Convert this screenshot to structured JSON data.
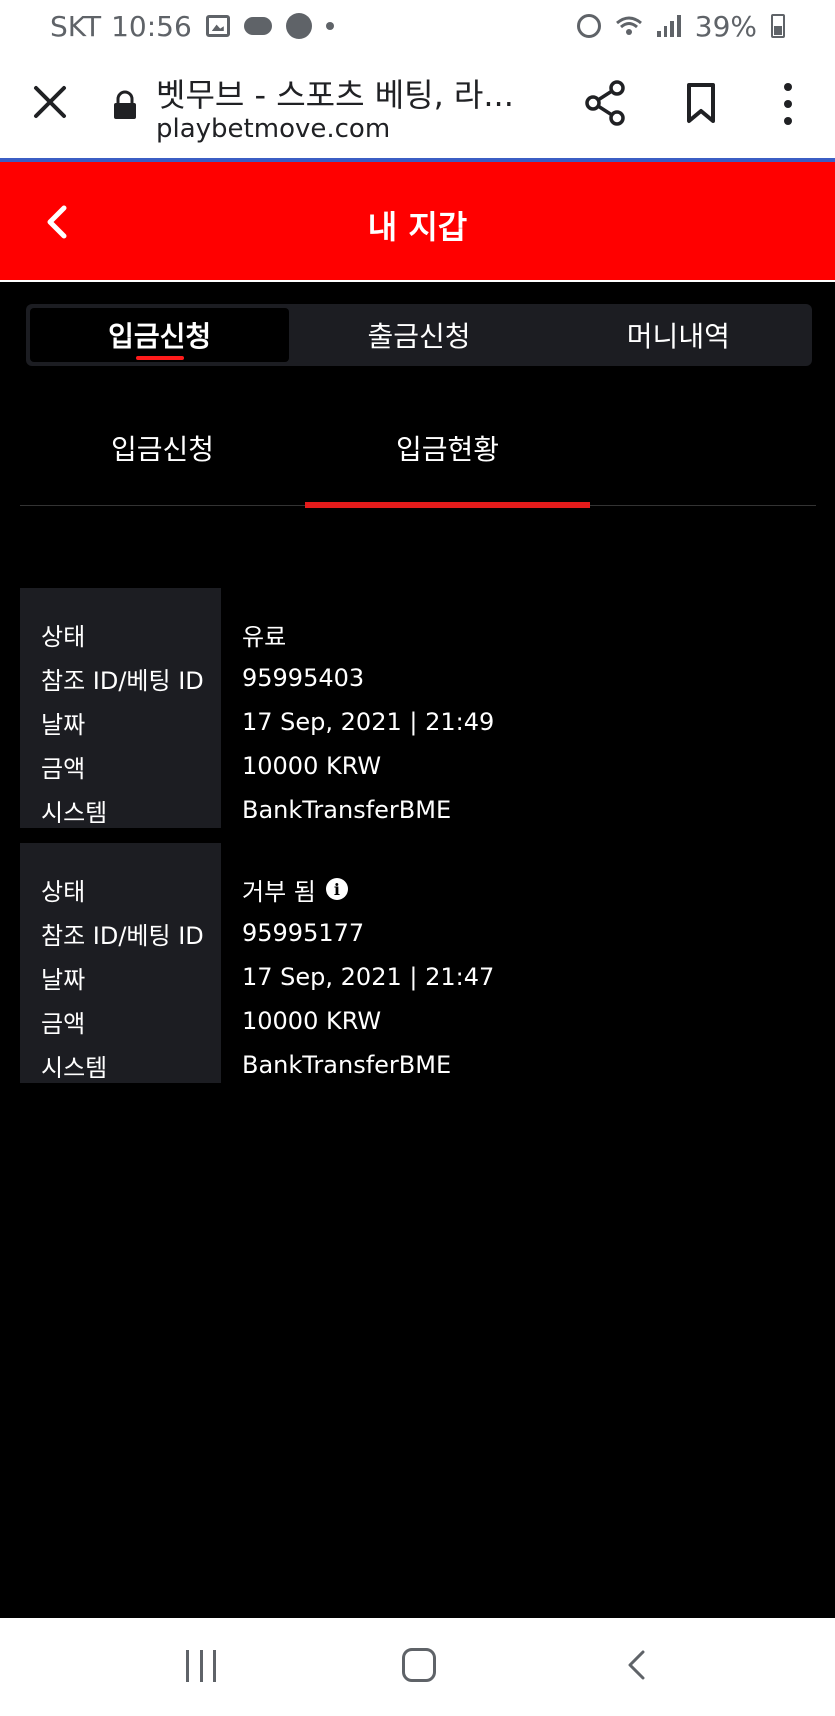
{
  "status_bar": {
    "carrier": "SKT",
    "time": "10:56",
    "battery": "39%"
  },
  "browser": {
    "page_title": "벳무브 - 스포츠 베팅, 라...",
    "url": "playbetmove.com"
  },
  "header": {
    "title": "내 지갑"
  },
  "main_tabs": [
    {
      "label": "입금신청",
      "active": true
    },
    {
      "label": "출금신청",
      "active": false
    },
    {
      "label": "머니내역",
      "active": false
    }
  ],
  "sub_tabs": [
    {
      "label": "입금신청",
      "active": false
    },
    {
      "label": "입금현황",
      "active": true
    }
  ],
  "records": [
    {
      "status_label": "상태",
      "status": "유료",
      "ref_label": "참조 ID/베팅 ID",
      "ref_id": "95995403",
      "date_label": "날짜",
      "date": "17 Sep, 2021 | 21:49",
      "amount_label": "금액",
      "amount": "10000 KRW",
      "system_label": "시스템",
      "system": "BankTransferBME"
    },
    {
      "status_label": "상태",
      "status": "거부 됨",
      "ref_label": "참조 ID/베팅 ID",
      "ref_id": "95995177",
      "date_label": "날짜",
      "date": "17 Sep, 2021 | 21:47",
      "amount_label": "금액",
      "amount": "10000 KRW",
      "system_label": "시스템",
      "system": "BankTransferBME"
    }
  ],
  "colors": {
    "header_red": "#ff0000",
    "tab_indicator": "#e31b1b",
    "panel_bg": "#1c1d22"
  },
  "icons": [
    "close-icon",
    "lock-icon",
    "share-icon",
    "bookmark-icon",
    "more-icon",
    "back-chevron-icon",
    "info-icon"
  ]
}
